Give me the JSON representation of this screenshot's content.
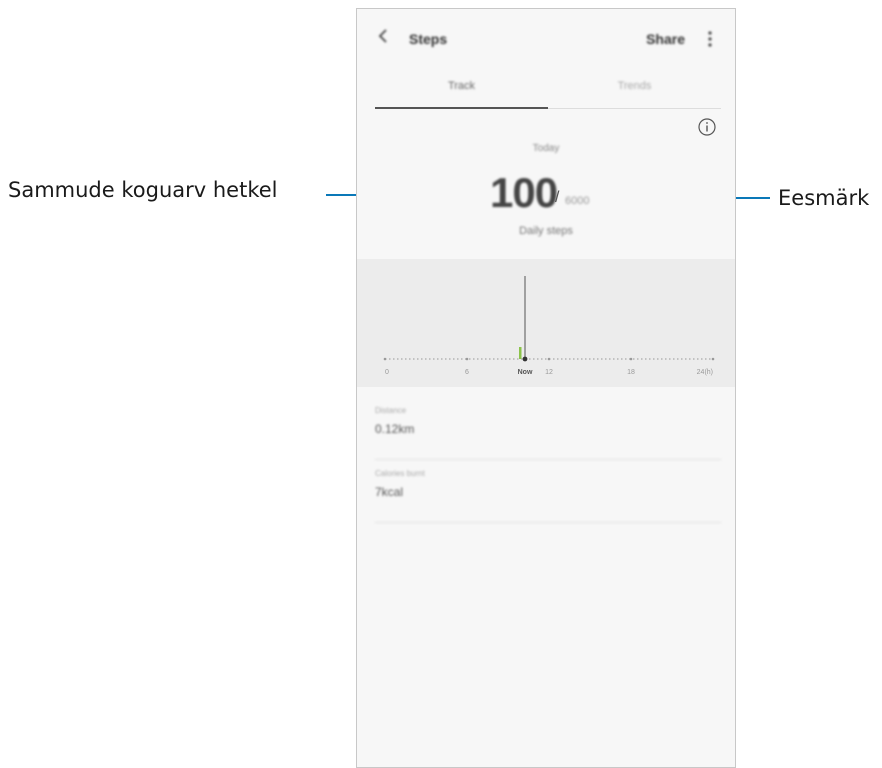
{
  "annotations": {
    "current_steps": "Sammude koguarv hetkel",
    "goal": "Eesmärk"
  },
  "app": {
    "title": "Steps",
    "share_label": "Share",
    "tabs": [
      {
        "label": "Track",
        "active": true
      },
      {
        "label": "Trends",
        "active": false
      }
    ],
    "today_label": "Today",
    "step_count": "100",
    "slash": "/",
    "goal_value": "6000",
    "daily_label": "Daily steps",
    "chart": {
      "tick_labels": [
        "0",
        "6",
        "Now",
        "12",
        "18",
        "24(h)"
      ],
      "current_value_hour": 10.5
    },
    "stats": [
      {
        "label": "Distance",
        "value": "0.12km"
      },
      {
        "label": "Calories burnt",
        "value": "7kcal"
      }
    ],
    "colors": {
      "annotation_line": "#0a78b8",
      "bar": "#8bc34a"
    }
  }
}
